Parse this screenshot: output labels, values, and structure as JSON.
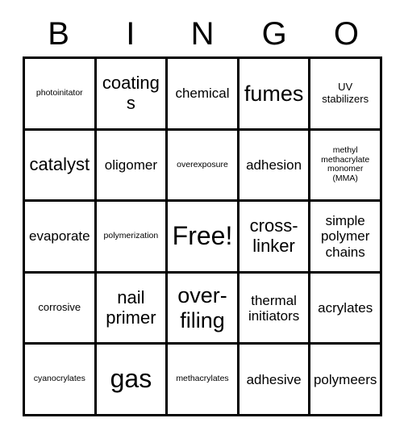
{
  "card": {
    "title_letters": [
      "B",
      "I",
      "N",
      "G",
      "O"
    ],
    "columns": 5,
    "rows": 5,
    "free_space": {
      "row": 2,
      "col": 2,
      "label": "Free!"
    },
    "colors": {
      "border": "#000000",
      "background": "#ffffff",
      "text": "#000000"
    },
    "cells": [
      [
        {
          "text": "photoinitator",
          "size": "xs"
        },
        {
          "text": "coatings",
          "size": "l"
        },
        {
          "text": "chemical",
          "size": "m"
        },
        {
          "text": "fumes",
          "size": "xl"
        },
        {
          "text": "UV\nstabilizers",
          "size": "s"
        }
      ],
      [
        {
          "text": "catalyst",
          "size": "l"
        },
        {
          "text": "oligomer",
          "size": "m"
        },
        {
          "text": "overexposure",
          "size": "xs"
        },
        {
          "text": "adhesion",
          "size": "m"
        },
        {
          "text": "methyl\nmethacrylate\nmonomer\n(MMA)",
          "size": "xs"
        }
      ],
      [
        {
          "text": "evaporate",
          "size": "m"
        },
        {
          "text": "polymerization",
          "size": "xs"
        },
        {
          "text": "Free!",
          "size": "xxl"
        },
        {
          "text": "cross-\nlinker",
          "size": "l"
        },
        {
          "text": "simple\npolymer\nchains",
          "size": "m"
        }
      ],
      [
        {
          "text": "corrosive",
          "size": "s"
        },
        {
          "text": "nail\nprimer",
          "size": "l"
        },
        {
          "text": "over-\nfiling",
          "size": "xl"
        },
        {
          "text": "thermal\ninitiators",
          "size": "m"
        },
        {
          "text": "acrylates",
          "size": "m"
        }
      ],
      [
        {
          "text": "cyanocrylates",
          "size": "xs"
        },
        {
          "text": "gas",
          "size": "xxl"
        },
        {
          "text": "methacrylates",
          "size": "xs"
        },
        {
          "text": "adhesive",
          "size": "m"
        },
        {
          "text": "polymeers",
          "size": "m"
        }
      ]
    ]
  }
}
